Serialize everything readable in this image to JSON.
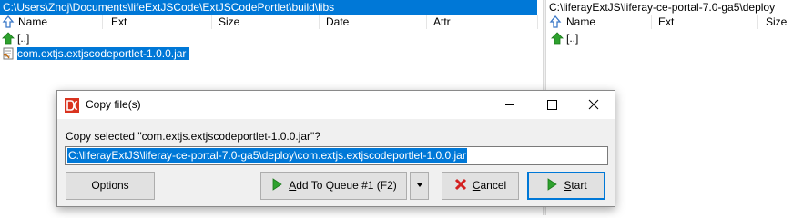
{
  "left_panel": {
    "path": "C:\\Users\\Znoj\\Documents\\lifeExtJSCode\\ExtJSCodePortlet\\build\\libs",
    "columns": [
      "Name",
      "Ext",
      "Size",
      "Date",
      "Attr"
    ],
    "parent_label": "[..]",
    "files": [
      "com.extjs.extjscodeportlet-1.0.0.jar"
    ]
  },
  "right_panel": {
    "path": "C:\\liferayExtJS\\liferay-ce-portal-7.0-ga5\\deploy",
    "columns": [
      "Name",
      "Ext",
      "Size"
    ],
    "parent_label": "[..]"
  },
  "dialog": {
    "title": "Copy file(s)",
    "prompt": "Copy selected \"com.extjs.extjscodeportlet-1.0.0.jar\"?",
    "destination": "C:\\liferayExtJS\\liferay-ce-portal-7.0-ga5\\deploy\\com.extjs.extjscodeportlet-1.0.0.jar",
    "buttons": {
      "options": "Options",
      "queue_mnemonic": "A",
      "queue_rest": "dd To Queue #1 (F2)",
      "cancel_mnemonic": "C",
      "cancel_rest": "ancel",
      "start_mnemonic": "S",
      "start_rest": "tart"
    }
  },
  "colors": {
    "selection": "#0078d7",
    "dialog_bg": "#f0f0f0",
    "arrow_green": "#2ea12e",
    "cancel_red": "#d42020"
  }
}
